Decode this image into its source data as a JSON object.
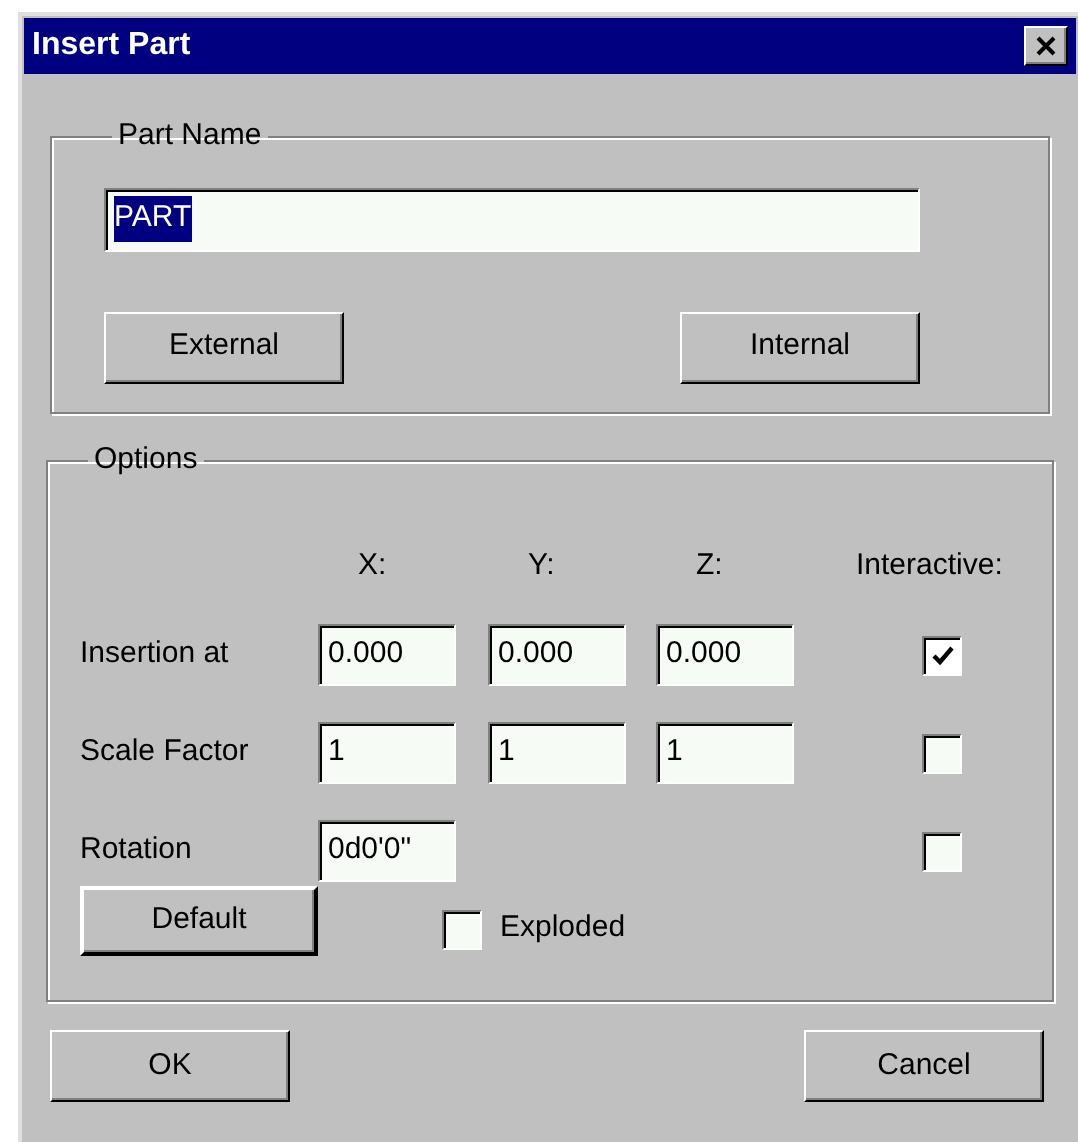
{
  "window": {
    "title": "Insert Part"
  },
  "part_name": {
    "legend": "Part Name",
    "value": "PART",
    "value_selected": true,
    "buttons": [
      {
        "label": "External"
      },
      {
        "label": "Internal"
      }
    ]
  },
  "options": {
    "legend": "Options",
    "columns": [
      "X:",
      "Y:",
      "Z:",
      "Interactive:"
    ],
    "rows": [
      {
        "label": "Insertion at",
        "values": [
          "0.000",
          "0.000",
          "0.000"
        ],
        "interactive": true
      },
      {
        "label": "Scale Factor",
        "values": [
          "1",
          "1",
          "1"
        ],
        "interactive": false
      },
      {
        "label": "Rotation",
        "values": [
          "0d0'0\""
        ],
        "interactive": false
      }
    ],
    "default_button": {
      "label": "Default"
    },
    "exploded": {
      "label": "Exploded",
      "checked": false
    }
  },
  "buttons": [
    {
      "label": "OK"
    },
    {
      "label": "Cancel"
    }
  ]
}
